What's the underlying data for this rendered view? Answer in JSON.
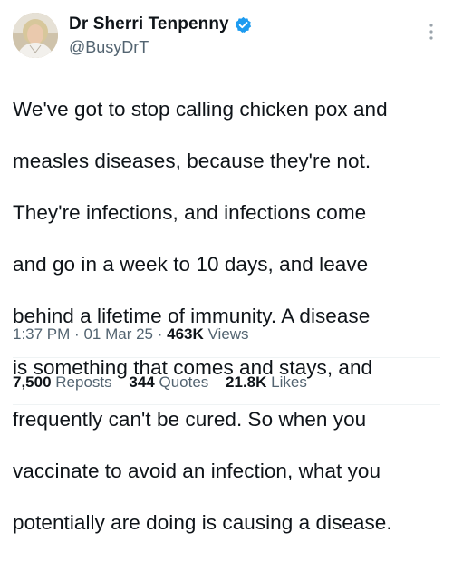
{
  "author": {
    "display_name": "Dr Sherri Tenpenny",
    "handle": "@BusyDrT",
    "verified": true
  },
  "tweet": {
    "lines": [
      "We've got to stop calling chicken pox and",
      "measles diseases, because they're not.",
      "They're infections, and infections come",
      "and go in a week to 10 days, and leave",
      "behind a lifetime of immunity.  A disease",
      "is something that comes and stays, and",
      "frequently can't be cured.  So when you",
      "vaccinate to avoid an infection, what you",
      "potentially are doing is causing a disease."
    ]
  },
  "meta": {
    "time": "1:37 PM",
    "separator": "·",
    "date": "01 Mar 25",
    "views_count": "463K",
    "views_label": "Views"
  },
  "stats": {
    "reposts_count": "7,500",
    "reposts_label": "Reposts",
    "quotes_count": "344",
    "quotes_label": "Quotes",
    "likes_count": "21.8K",
    "likes_label": "Likes"
  },
  "icons": {
    "verified": "verified-badge-icon",
    "more": "more-options-icon"
  },
  "colors": {
    "text": "#0f1419",
    "secondary": "#536471",
    "verified": "#1d9bf0",
    "divider": "#eff3f4"
  }
}
